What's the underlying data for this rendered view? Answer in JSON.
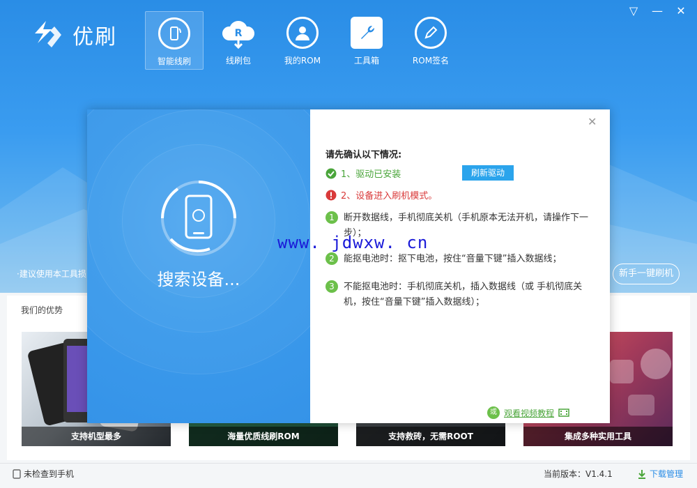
{
  "app": {
    "logo_text": "优刷",
    "window_controls": [
      "▽",
      "—",
      "✕"
    ]
  },
  "nav": [
    {
      "label": "智能线刷",
      "icon": "phone-refresh-icon",
      "active": true
    },
    {
      "label": "线刷包",
      "icon": "cloud-download-icon",
      "active": false
    },
    {
      "label": "我的ROM",
      "icon": "user-icon",
      "active": false
    },
    {
      "label": "工具箱",
      "icon": "wrench-icon",
      "active": false
    },
    {
      "label": "ROM签名",
      "icon": "pen-icon",
      "active": false
    }
  ],
  "header": {
    "tip": "·建议使用本工具损",
    "new_user_button": "新手一键刷机"
  },
  "advantages": {
    "title": "我们的优势",
    "cards": [
      {
        "caption": "支持机型最多"
      },
      {
        "caption": "海量优质线刷ROM"
      },
      {
        "caption": "支持救砖，无需ROOT"
      },
      {
        "caption": "集成多种实用工具"
      }
    ]
  },
  "modal": {
    "searching_label": "搜索设备...",
    "title": "请先确认以下情况:",
    "check1": "1、驱动已安装",
    "refresh_button": "刷新驱动",
    "check2": "2、设备进入刷机模式。",
    "steps": [
      {
        "num": "1",
        "text": "断开数据线，手机彻底关机（手机原本无法开机，请操作下一步）；"
      },
      {
        "num": "2",
        "text": "能抠电池时：抠下电池，按住“音量下键”插入数据线；"
      },
      {
        "num": "3",
        "text": "不能抠电池时：手机彻底关机，插入数据线（或 手机彻底关机，按住“音量下键”插入数据线）；"
      }
    ],
    "or_label": "或",
    "video_link": "观看视频教程"
  },
  "status": {
    "device_status": "未检查到手机",
    "version_label": "当前版本：",
    "version_value": "V1.4.1",
    "download_manager": "下载管理"
  },
  "watermark": "www. jdwxw. cn",
  "colors": {
    "primary": "#2a8de6",
    "success": "#4aa53a",
    "error": "#d93a3a",
    "button": "#2ba4ec"
  }
}
